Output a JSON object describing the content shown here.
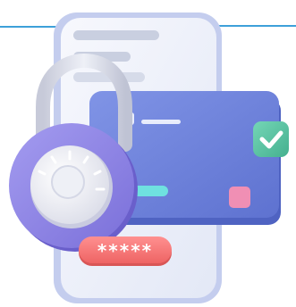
{
  "illustration": {
    "icons": {
      "phone": "smartphone-icon",
      "card": "credit-card-icon",
      "lock": "padlock-icon",
      "check": "check-badge-icon",
      "password": "password-field-icon"
    },
    "password_mask": "*****",
    "colors": {
      "accent_line": "#3da0d9",
      "phone_body": "#f0f3fa",
      "phone_frame": "#c4cdee",
      "card_main": "#6f83dc",
      "card_dark": "#4f63c2",
      "lock_body": "#8c83e6",
      "lock_shackle": "#d9dbe8",
      "dial": "#f1f2f7",
      "check_badge": "#5cc6a4",
      "chip": "#f08fb4",
      "password_pill": "#f77a7a",
      "card_stripe": "#6fe1e0"
    }
  }
}
